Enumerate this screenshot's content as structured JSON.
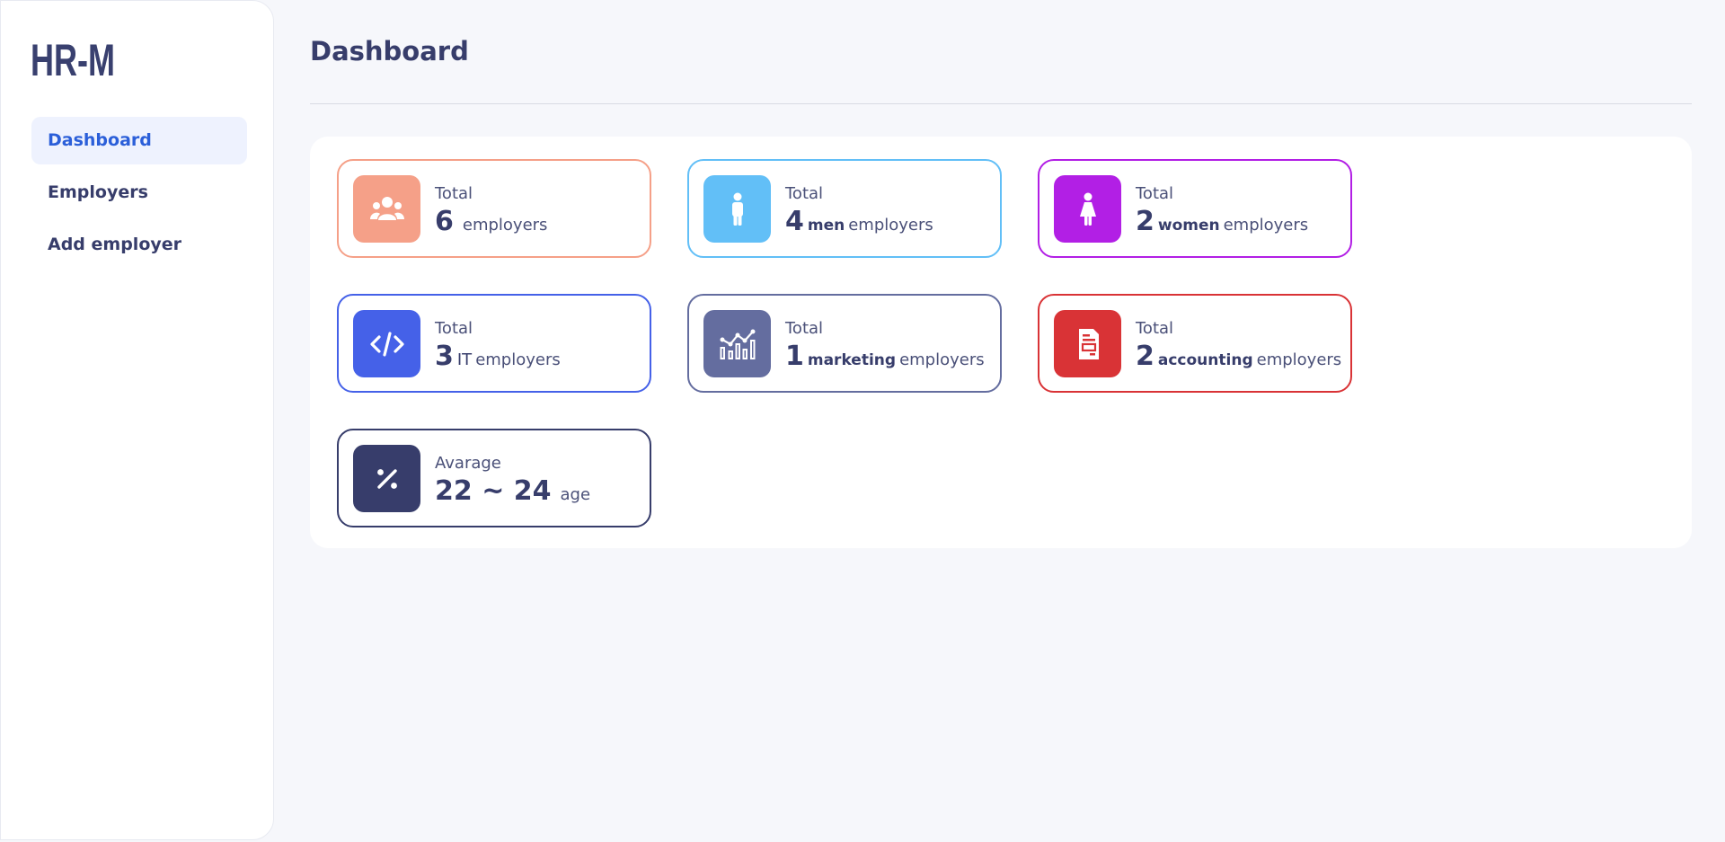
{
  "app": {
    "logo": "HR-M"
  },
  "sidebar": {
    "items": [
      {
        "label": "Dashboard",
        "active": true
      },
      {
        "label": "Employers"
      },
      {
        "label": "Add employer"
      }
    ]
  },
  "page": {
    "title": "Dashboard"
  },
  "cards": [
    {
      "label": "Total",
      "value": "6",
      "dept": "",
      "unit": "employers",
      "icon": "users-icon",
      "color": "#f5a088"
    },
    {
      "label": "Total",
      "value": "4",
      "dept": "men",
      "unit": "employers",
      "icon": "man-icon",
      "color": "#62bff7"
    },
    {
      "label": "Total",
      "value": "2",
      "dept": "women",
      "unit": "employers",
      "icon": "woman-icon",
      "color": "#b21fe5"
    },
    {
      "label": "Total",
      "value": "3",
      "dept": "IT",
      "unit": "employers",
      "icon": "code-icon",
      "color": "#4561e8"
    },
    {
      "label": "Total",
      "value": "1",
      "dept": "marketing",
      "unit": "employers",
      "icon": "chart-icon",
      "color": "#646d9f"
    },
    {
      "label": "Total",
      "value": "2",
      "dept": "accounting",
      "unit": "employers",
      "icon": "invoice-icon",
      "color": "#d93336"
    },
    {
      "label": "Avarage",
      "value": "22 ~ 24",
      "dept": "",
      "unit": "age",
      "icon": "percent-icon",
      "color": "#373d6b"
    }
  ]
}
